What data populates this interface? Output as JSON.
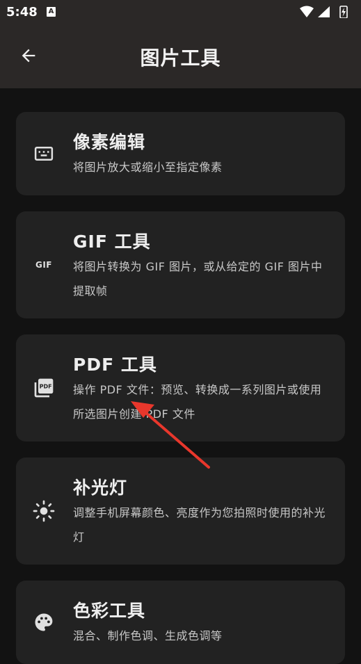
{
  "status": {
    "time": "5:48",
    "notif_letter": "A"
  },
  "appbar": {
    "title": "图片工具"
  },
  "icons": {
    "back": "back-arrow-icon",
    "pixel": "pixel-edit-icon",
    "gif": "gif-icon",
    "pdf": "pdf-icon",
    "light": "brightness-icon",
    "color": "palette-icon"
  },
  "cards": [
    {
      "title": "像素编辑",
      "desc": "将图片放大或缩小至指定像素"
    },
    {
      "title": "GIF 工具",
      "desc": "将图片转换为 GIF 图片，或从给定的 GIF 图片中提取帧",
      "icon_text": "GIF"
    },
    {
      "title": "PDF 工具",
      "desc": "操作 PDF 文件：预览、转换成一系列图片或使用所选图片创建 PDF 文件"
    },
    {
      "title": "补光灯",
      "desc": "调整手机屏幕颜色、亮度作为您拍照时使用的补光灯"
    },
    {
      "title": "色彩工具",
      "desc": "混合、制作色调、生成色调等"
    }
  ],
  "colors": {
    "bar": "#2b2827",
    "bg": "#121212",
    "card": "#222222",
    "annotation": "#e8372c"
  }
}
